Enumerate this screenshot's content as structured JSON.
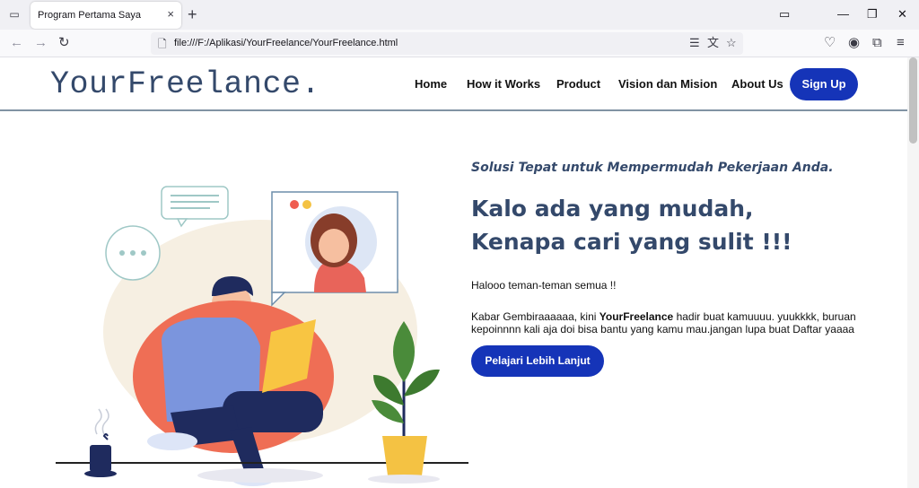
{
  "browser": {
    "tab_title": "Program Pertama Saya",
    "tab_close": "×",
    "new_tab": "+",
    "url": "file:///F:/Aplikasi/YourFreelance/YourFreelance.html"
  },
  "site": {
    "logo": "YourFreelance.",
    "nav": [
      "Home",
      "How it Works",
      "Product",
      "Vision dan Mision",
      "About Us"
    ],
    "signup": "Sign Up"
  },
  "hero": {
    "subtitle": "Solusi Tepat untuk Mempermudah Pekerjaan Anda.",
    "title": "Kalo ada yang mudah, Kenapa cari yang sulit !!!",
    "greeting": "Halooo teman-teman semua !!",
    "desc_before": "Kabar Gembiraaaaaa, kini ",
    "desc_bold": "YourFreelance",
    "desc_after": " hadir buat kamuuuu. yuukkkk, buruan kepoinnnn kali aja doi bisa bantu yang kamu mau.jangan lupa buat Daftar yaaaa",
    "cta": "Pelajari Lebih Lanjut"
  },
  "colors": {
    "brand_blue": "#1534b8",
    "heading": "#34496b"
  }
}
